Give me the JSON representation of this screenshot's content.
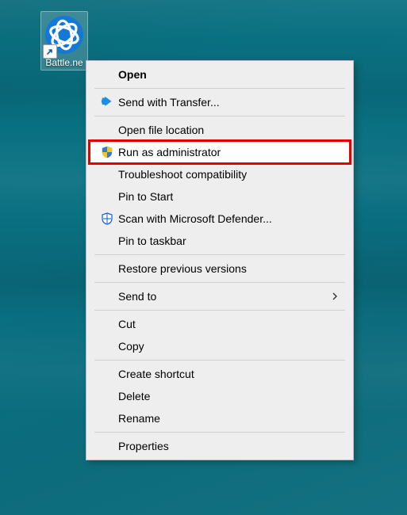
{
  "desktop": {
    "shortcut": {
      "label": "Battle.ne",
      "icon_name": "battlenet-icon"
    }
  },
  "context_menu": {
    "open": "Open",
    "send_with_transfer": "Send with Transfer...",
    "open_file_location": "Open file location",
    "run_as_admin": "Run as administrator",
    "troubleshoot_compat": "Troubleshoot compatibility",
    "pin_to_start": "Pin to Start",
    "scan_defender": "Scan with Microsoft Defender...",
    "pin_to_taskbar": "Pin to taskbar",
    "restore_previous": "Restore previous versions",
    "send_to": "Send to",
    "cut": "Cut",
    "copy": "Copy",
    "create_shortcut": "Create shortcut",
    "delete": "Delete",
    "rename": "Rename",
    "properties": "Properties"
  },
  "icons": {
    "transfer": "transfer-icon",
    "shield_admin": "uac-shield-icon",
    "defender": "defender-shield-icon",
    "shortcut_arrow": "shortcut-arrow-icon",
    "submenu_arrow": "›"
  },
  "highlight": "run_as_admin"
}
